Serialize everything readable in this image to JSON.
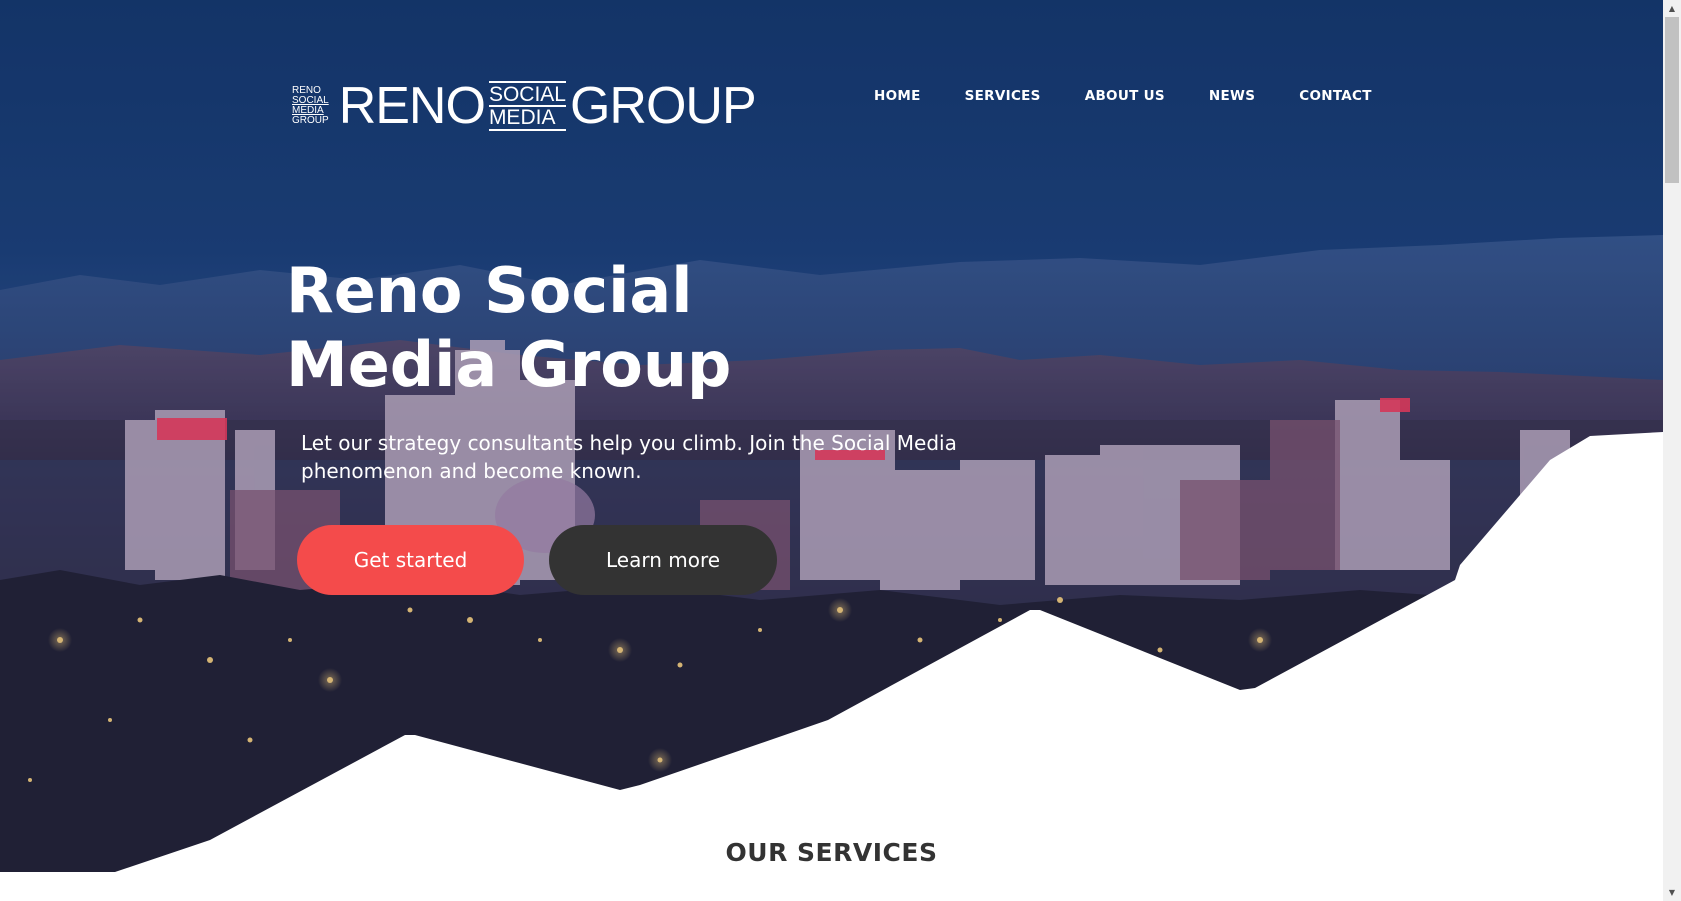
{
  "logo": {
    "small_lines": [
      "RENO",
      "SOCIAL",
      "MEDIA",
      "GROUP"
    ],
    "reno": "RENO",
    "social": "SOCIAL",
    "media": "MEDIA",
    "group": "GROUP"
  },
  "nav": {
    "items": [
      {
        "label": "HOME"
      },
      {
        "label": "SERVICES"
      },
      {
        "label": "ABOUT US"
      },
      {
        "label": "NEWS"
      },
      {
        "label": "CONTACT"
      }
    ]
  },
  "hero": {
    "title_line1": "Reno Social",
    "title_line2": "Media Group",
    "subtitle_line1": "Let our strategy consultants help you climb. Join the Social Media",
    "subtitle_line2": "phenomenon and become known.",
    "primary_button": "Get started",
    "secondary_button": "Learn more"
  },
  "services": {
    "title": "OUR SERVICES"
  },
  "colors": {
    "primary_button": "#f44b4b",
    "secondary_button": "#333333",
    "sky_top": "#14366b",
    "heading_dark": "#333333"
  },
  "scrollbar": {
    "up_icon": "triangle-up",
    "down_icon": "triangle-down"
  }
}
